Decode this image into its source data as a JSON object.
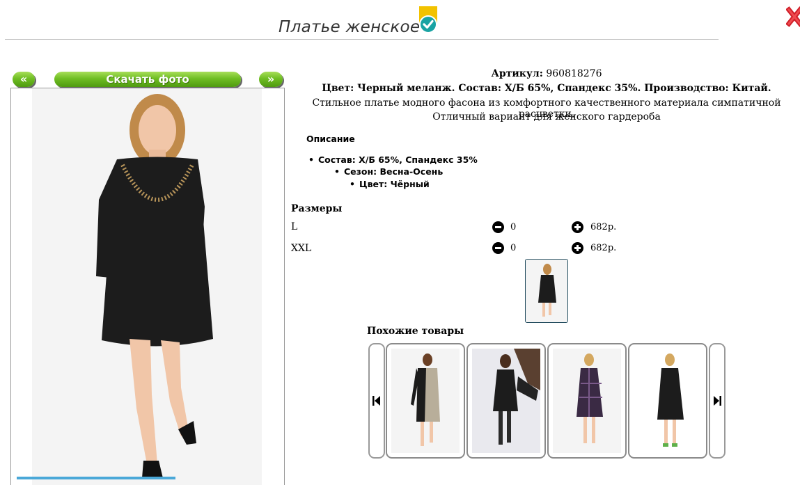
{
  "header": {
    "title": "Платье женское",
    "badge_icon": "check-badge-icon",
    "close_icon": "close-icon"
  },
  "gallery": {
    "prev_label": "«",
    "download_label": "Скачать фото",
    "next_label": "»"
  },
  "product": {
    "article_label": "Артикул:",
    "article_value": "960818276",
    "color_line": "Цвет: Черный меланж. Состав: Х/Б 65%, Спандекс 35%. Производство: Китай.",
    "description_line1": "Стильное платье модного фасона из комфортного качественного материала симпатичной расцветки.",
    "description_line2": "Отличный  вариант для женского гардероба"
  },
  "specs": {
    "heading": "Описание",
    "items": [
      "Состав: Х/Б 65%, Спандекс 35%",
      "Сезон: Весна-Осень",
      "Цвет: Чёрный"
    ]
  },
  "sizes": {
    "heading": "Размеры",
    "rows": [
      {
        "name": "L",
        "qty": "0",
        "price": "682р."
      },
      {
        "name": "XXL",
        "qty": "0",
        "price": "682р."
      }
    ]
  },
  "similar": {
    "heading": "Похожие товары",
    "prev_icon": "carousel-prev-icon",
    "next_icon": "carousel-next-icon"
  },
  "colors": {
    "button_green": "#6fbe23",
    "close_red": "#d0202a",
    "badge_yellow": "#f2c200",
    "badge_teal": "#1aa3a3"
  }
}
